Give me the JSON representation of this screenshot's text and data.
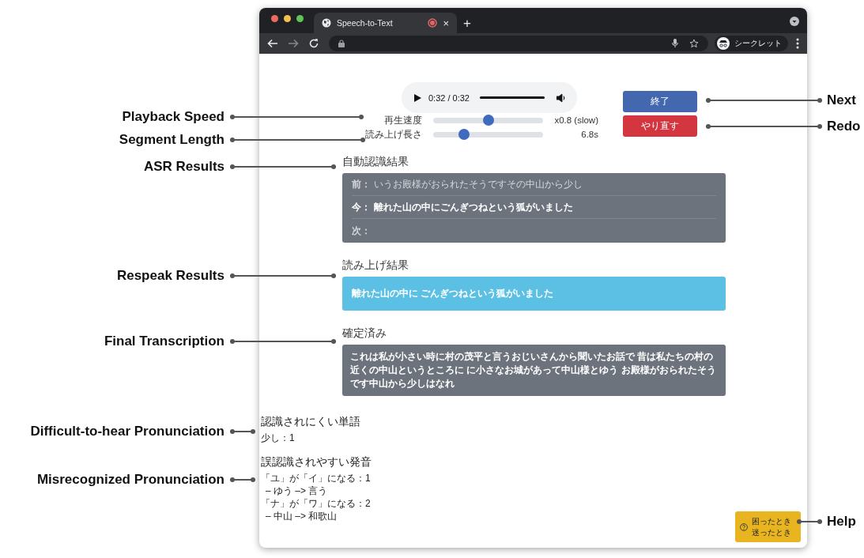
{
  "annotations": [
    {
      "label": "Playback Speed"
    },
    {
      "label": "Segment Length"
    },
    {
      "label": "ASR Results"
    },
    {
      "label": "Respeak Results"
    },
    {
      "label": "Final Transcription"
    },
    {
      "label": "Difficult-to-hear Pronunciation"
    },
    {
      "label": "Misrecognized Pronunciation"
    },
    {
      "label": "Next"
    },
    {
      "label": "Redo"
    },
    {
      "label": "Help"
    }
  ],
  "browser": {
    "tab_title": "Speech-to-Text",
    "tab_close": "×",
    "new_tab": "+",
    "forward": {
      "disabled": true
    },
    "profile": "シークレット"
  },
  "player": {
    "time": "0:32 / 0:32",
    "level": 1
  },
  "sliders": [
    {
      "label": "再生速度",
      "level": 0.5,
      "reading": "x0.8 (slow)"
    },
    {
      "label": "読み上げ長さ",
      "level": 0.28,
      "reading": "6.8s"
    }
  ],
  "buttons": [
    {
      "label": "終了",
      "kind": "primary"
    },
    {
      "label": "やり直す",
      "kind": "danger"
    }
  ],
  "asr": {
    "heading": "自動認識結果",
    "rows": [
      {
        "label": "前：",
        "text": "いうお殿様がおられたそうですその中山から少し",
        "current": false
      },
      {
        "label": "今：",
        "text": "離れた山の中にごんぎつねという狐がいました",
        "current": true
      },
      {
        "label": "次：",
        "current": false
      }
    ]
  },
  "respeak": {
    "heading": "読み上げ結果",
    "text": "離れた山の中に ごんぎつねという狐がいました"
  },
  "final": {
    "heading": "確定済み",
    "text": "これは私が小さい時に村の茂平と言うおじいさんから聞いたお話で 昔は私たちの村の近くの中山というところに に小さなお城があって中山様とゆう お殿様がおられたそうです中山から少しはなれ"
  },
  "difficult": {
    "heading": "認識されにくい単語",
    "items": [
      {
        "text": "少し：1"
      }
    ]
  },
  "misrecognized": {
    "heading": "誤認識されやすい発音",
    "items": [
      {
        "text": "「ユ」が「イ」になる：1",
        "children": [
          {
            "text": "– ゆう –> 言う"
          }
        ]
      },
      {
        "text": "「ナ」が「ワ」になる：2",
        "children": [
          {
            "text": "– 中山 –> 和歌山"
          }
        ]
      }
    ]
  },
  "help": {
    "lines": [
      "困ったとき",
      "迷ったとき"
    ]
  }
}
